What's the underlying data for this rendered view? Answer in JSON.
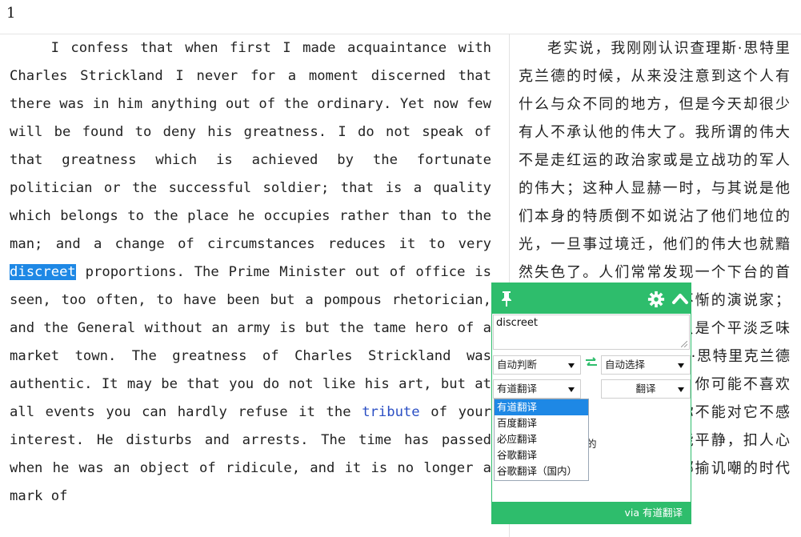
{
  "page": {
    "number": "1"
  },
  "english": {
    "before_highlight": "I confess that when first I made acquaintance with Charles Strickland I never for a moment discerned that there was in him anything out of the ordinary. Yet now few will be found to deny his greatness. I do not speak of that greatness which is achieved by the fortunate politician or the successful soldier; that is a quality which belongs to the place he occupies rather than to the man; and a change of circumstances reduces it to very ",
    "highlight": "discreet",
    "middle": " proportions. The Prime Minister out of office is seen, too often, to have been but a pompous rhetorician, and the General without an army is but the tame hero of a market town. The greatness of Charles Strickland was authentic. It may be that you do not like his art, but at all events you can hardly refuse it the ",
    "link": "tribute",
    "after_link": " of your interest. He disturbs and arrests. The time has passed when he was an object of ridicule, and it is no longer a mark of"
  },
  "chinese": {
    "text": "老实说，我刚刚认识查理斯·思特里克兰德的时候，从来没注意到这个人有什么与众不同的地方，但是今天却很少有人不承认他的伟大了。我所谓的伟大不是走红运的政治家或是立战功的军人的伟大；这种人显赫一时，与其说是他们本身的特质倒不如说沾了他们地位的光，一旦事过境迁，他们的伟大也就黯然失色了。人们常常发现一个下台的首相当年只不过是个大言不惭的演说家；一个解甲归田的将军也只是个平淡乏味的市井英雄。但是查理斯·思特里克兰德的伟大却是真正的伟大。你可能不喜欢他的艺术，但无论如何你不能对它不感兴趣。他的作品使你不能平静，扣人心弦。思特里克兰德受人揶揄讥嘲的时代已经过去了，为他"
  },
  "popup": {
    "input_value": "discreet",
    "source_lang": "自动判断",
    "target_lang": "自动选择",
    "engine": "有道翻译",
    "translate_label": "翻译",
    "result_fragment": "的",
    "footer": "via 有道翻译",
    "engine_options": [
      "有道翻译",
      "百度翻译",
      "必应翻译",
      "谷歌翻译",
      "谷歌翻译（国内）"
    ],
    "accent_color": "#2ebd6c",
    "selected_color": "#1e88e5",
    "icons": [
      "pin-icon",
      "gear-icon",
      "chevron-up-icon",
      "swap-icon"
    ]
  }
}
